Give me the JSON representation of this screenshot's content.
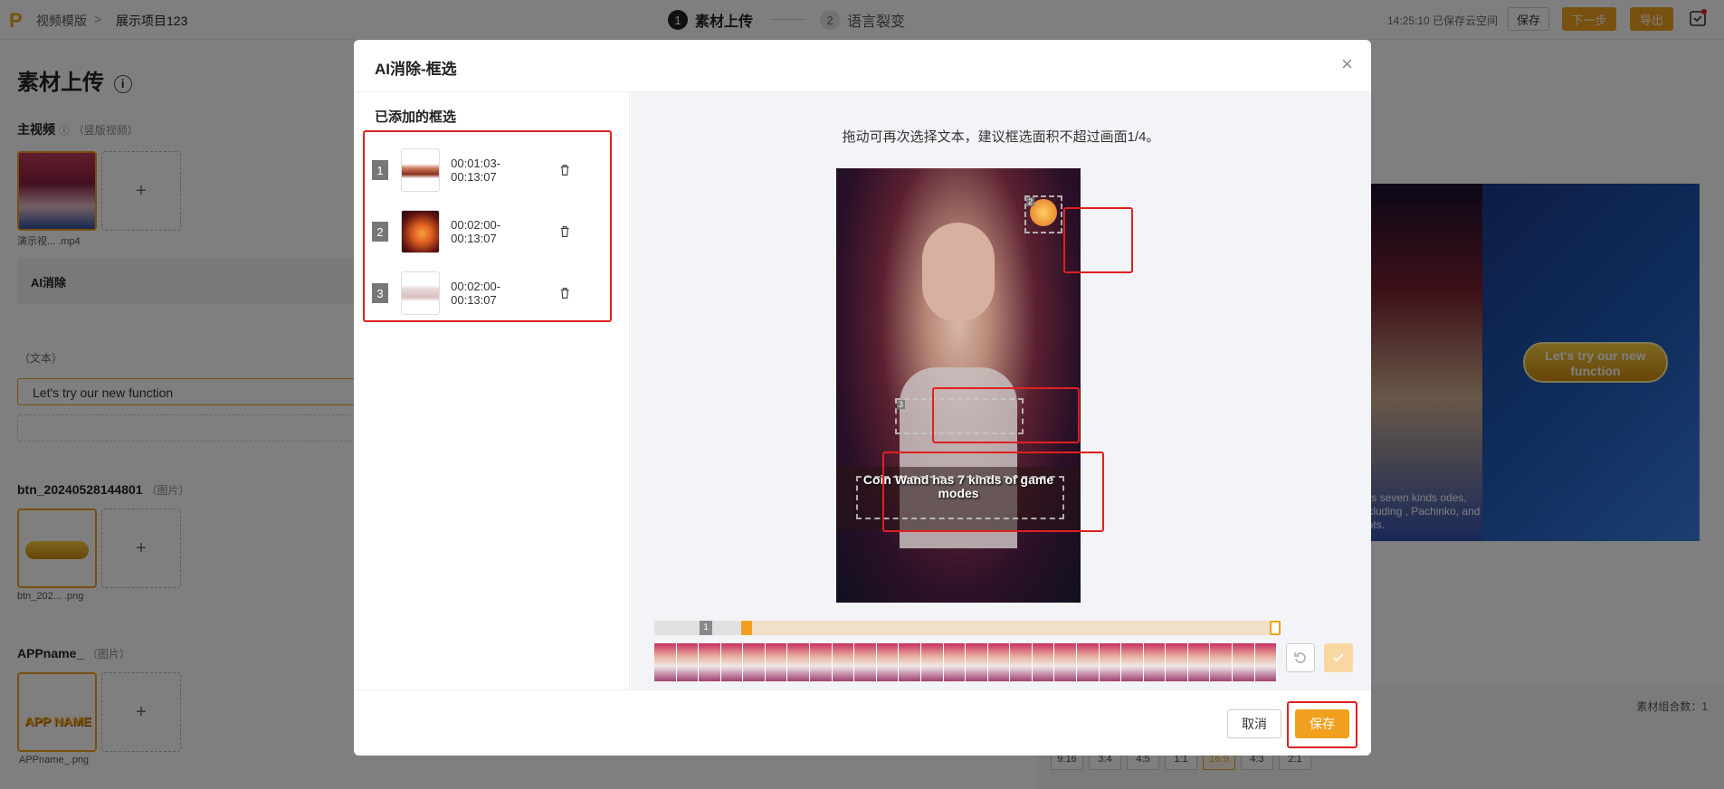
{
  "topbar": {
    "logo": "P",
    "breadcrumb": [
      "视频模版",
      ">",
      "展示项目123"
    ],
    "steps": [
      {
        "num": "1",
        "label": "素材上传"
      },
      {
        "num": "2",
        "label": "语言裂变"
      }
    ],
    "save_status": "14:25:10 已保存云空间",
    "save_label": "保存",
    "next_label": "下一步",
    "export_label": "导出"
  },
  "page": {
    "title": "素材上传",
    "main_video_label": "主视频",
    "main_video_hint": "（竖版视频）",
    "main_video_file": "演示视...  .mp4",
    "ai_section": "AI消除",
    "text_label": "（文本）",
    "text_value": "Let's try our new function",
    "btn_label": "btn_20240528144801",
    "btn_hint": "（图片）",
    "btn_file": "btn_202...  .png",
    "appname_label": "APPname_",
    "appname_hint": "（图片）",
    "appname_file": "APPname_.png",
    "app_logo_text": "APP NAME",
    "preview_button_text": "Let's try our new function",
    "preview_caption": "has seven kinds odes, including , Pachinko, and slots.",
    "combo_count_label": "素材组合数：1",
    "ratios": [
      "9:16",
      "3:4",
      "4:5",
      "1:1",
      "16:9",
      "4:3",
      "2:1"
    ],
    "active_ratio": "16:9"
  },
  "modal": {
    "title": "AI消除-框选",
    "close": "×",
    "list_title": "已添加的框选",
    "items": [
      {
        "index": "1",
        "time": "00:01:03-00:13:07"
      },
      {
        "index": "2",
        "time": "00:02:00-00:13:07"
      },
      {
        "index": "3",
        "time": "00:02:00-00:13:07"
      }
    ],
    "instruction": "拖动可再次选择文本，建议框选面积不超过画面1/4。",
    "video_subtitle": "Coin Wand has 7 kinds of game modes",
    "box_labels": [
      "2",
      "3"
    ],
    "track_marker": "1",
    "cancel_label": "取消",
    "save_label": "保存"
  },
  "colors": {
    "accent": "#f0a01e",
    "highlight": "#e02020",
    "overlay": "rgba(0,0,0,0.5)"
  }
}
